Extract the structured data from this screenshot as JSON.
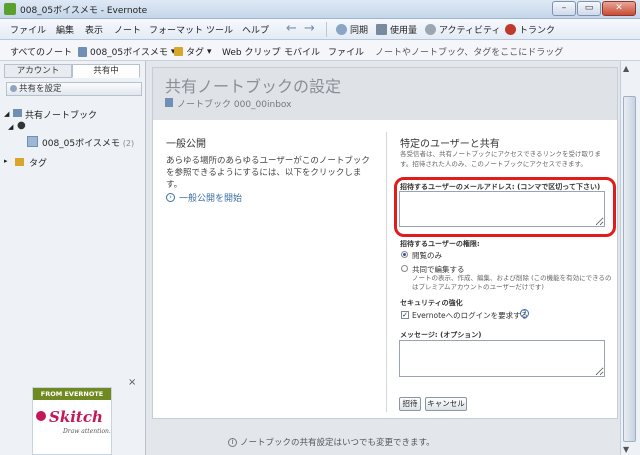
{
  "window": {
    "title": "008_05ボイスメモ - Evernote",
    "minimize": "–",
    "maximize": "▭",
    "close": "✕"
  },
  "menubar": {
    "items": [
      "ファイル",
      "編集",
      "表示",
      "ノート",
      "フォーマット",
      "ツール",
      "ヘルプ"
    ],
    "back": "←",
    "forward": "→",
    "sync": "同期",
    "usage": "使用量",
    "activity": "アクティビティ",
    "trunk": "トランク"
  },
  "toolbar2": {
    "all_notes": "すべてのノート",
    "notebook": "008_05ボイスメモ",
    "tags": "タグ",
    "web_clip": "Web クリップ",
    "mobile": "モバイル",
    "file": "ファイル",
    "drop_hint": "ノートやノートブック、タグをここにドラッグ"
  },
  "sidebar": {
    "tabs": [
      "アカウント",
      "共有中"
    ],
    "setting_button": "共有を設定",
    "shared_notebooks": "共有ノートブック",
    "notebook_name": "008_05ボイスメモ",
    "notebook_count": "(2)",
    "tags": "タグ"
  },
  "promo": {
    "header": "FROM EVERNOTE",
    "logo": "Skitch",
    "tagline": "Draw attention.",
    "close": "×"
  },
  "main": {
    "title": "共有ノートブックの設定",
    "notebook_line": "ノートブック 000_00inbox",
    "public": {
      "heading": "一般公開",
      "description": "あらゆる場所のあらゆるユーザーがこのノートブックを参照できるようにするには、以下をクリックします。",
      "start_link": "一般公開を開始"
    },
    "share": {
      "heading": "特定のユーザーと共有",
      "description": "各受信者は、共有ノートブックにアクセスできるリンクを受け取ります。招待された人のみ、このノートブックにアクセスできます。",
      "email_label": "招待するユーザーのメールアドレス: (コンマで区切って下さい)",
      "permission_label": "招待するユーザーの権限:",
      "opt_view": "閲覧のみ",
      "opt_edit": "共同で編集する",
      "opt_edit_note": "ノートの表示、作成、編集、および削除 (この機能を有効にできるのはプレミアムアカウントのユーザーだけです)",
      "security_label": "セキュリティの強化",
      "require_login": "Evernoteへのログインを要求する",
      "help": "?",
      "message_label": "メッセージ: (オプション)",
      "invite_button": "招待",
      "cancel_button": "キャンセル"
    },
    "footer_note": "ノートブックの共有設定はいつでも変更できます。"
  }
}
